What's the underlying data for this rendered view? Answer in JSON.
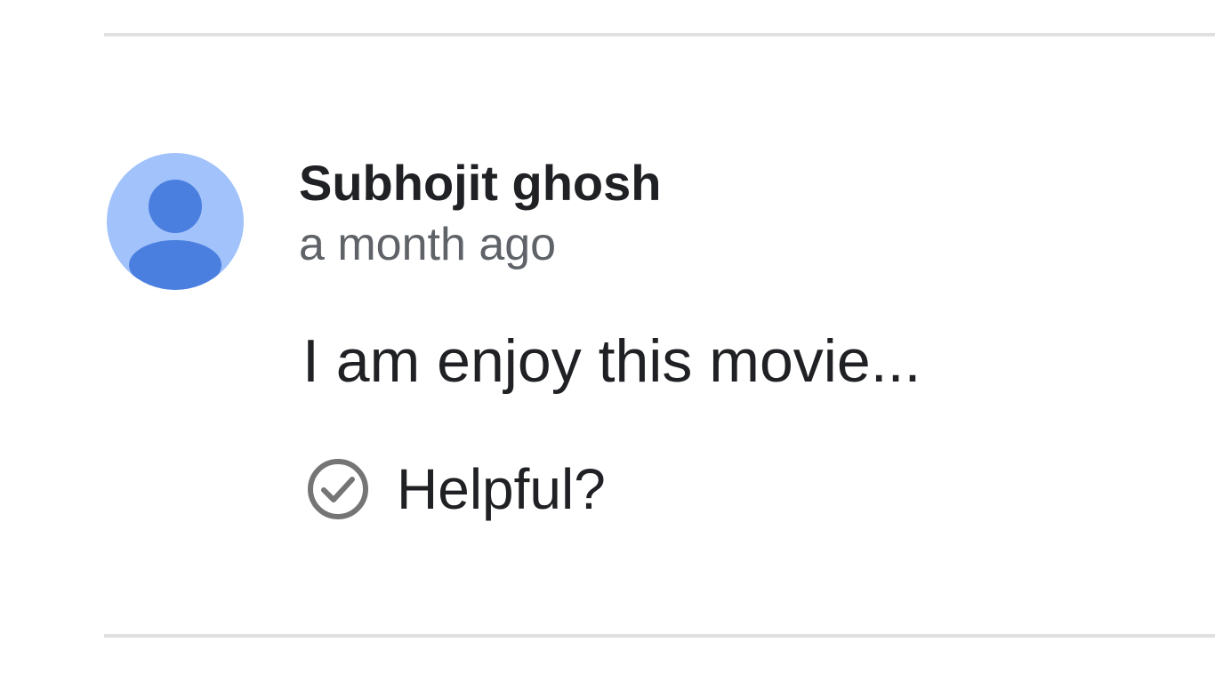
{
  "review": {
    "author": "Subhojit ghosh",
    "timestamp": "a month ago",
    "text": "I am enjoy this movie...",
    "helpful_label": "Helpful?",
    "avatar_icon": "default-person-icon",
    "helpful_icon": "check-circle-icon"
  },
  "colors": {
    "avatar_background": "#a1c2fa",
    "avatar_figure": "#4a7fe0",
    "divider": "#e0e0e0",
    "primary_text": "#202124",
    "secondary_text": "#5f6368",
    "icon": "#757575"
  }
}
